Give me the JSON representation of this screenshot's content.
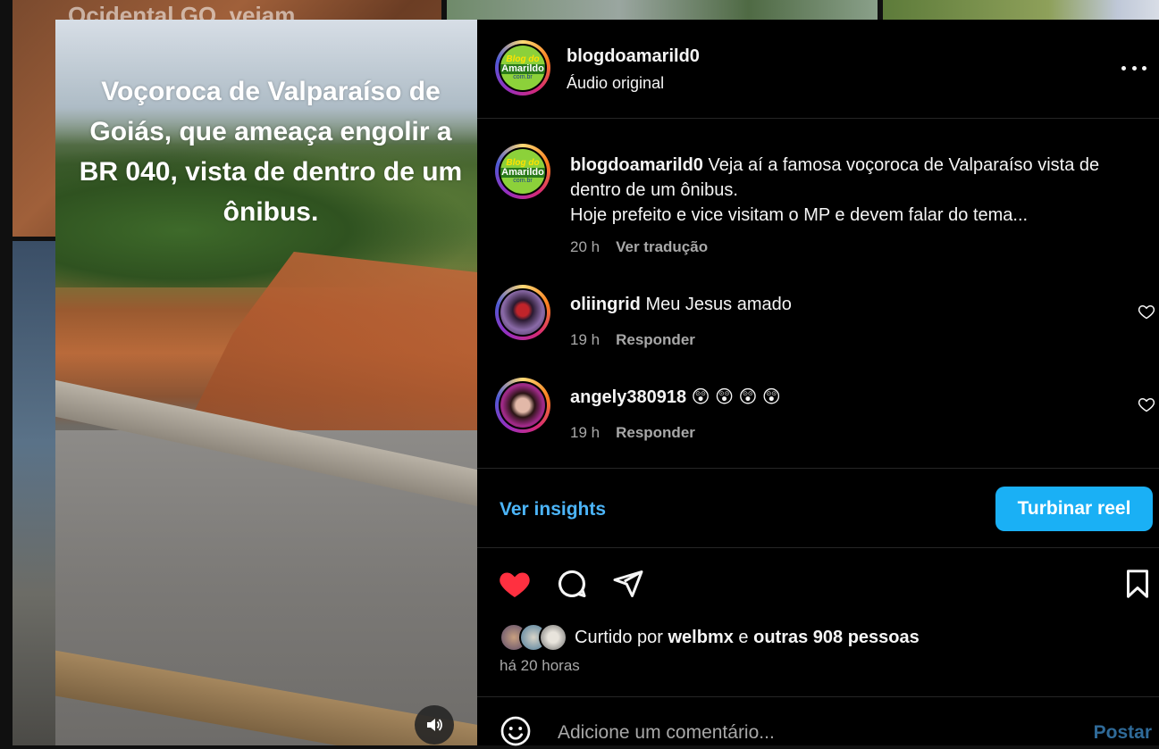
{
  "background": {
    "partial_caption": "Ocidental GO, vejam"
  },
  "video": {
    "caption": "Voçoroca de Valparaíso de Goiás, que ameaça engolir a BR 040, vista de dentro de um ônibus.",
    "mute_icon": "speaker-icon"
  },
  "header": {
    "username": "blogdoamarild0",
    "audio": "Áudio original",
    "logo_line1": "Blog do",
    "logo_line2": "Amarildo",
    "logo_line3": "com.br"
  },
  "comments": [
    {
      "username": "blogdoamarild0",
      "text": "Veja aí a famosa voçoroca de Valparaíso vista de dentro de um ônibus.",
      "text2": "Hoje prefeito e vice visitam o MP e devem falar do tema...",
      "time": "20 h",
      "action": "Ver tradução"
    },
    {
      "username": "oliingrid",
      "text": "Meu Jesus amado",
      "time": "19 h",
      "action": "Responder"
    },
    {
      "username": "angely380918",
      "text": "😲 😲 😲 😲",
      "time": "19 h",
      "action": "Responder"
    }
  ],
  "insights": {
    "link": "Ver insights",
    "boost": "Turbinar reel"
  },
  "actions": {
    "like_icon": "heart-icon",
    "comment_icon": "comment-icon",
    "share_icon": "share-icon",
    "save_icon": "bookmark-icon",
    "like_color": "#ff3040"
  },
  "likes": {
    "prefix": "Curtido por",
    "user": "welbmx",
    "connector": "e",
    "others": "outras 908 pessoas",
    "time_ago": "há 20 horas"
  },
  "add_comment": {
    "placeholder": "Adicione um comentário...",
    "post": "Postar"
  }
}
